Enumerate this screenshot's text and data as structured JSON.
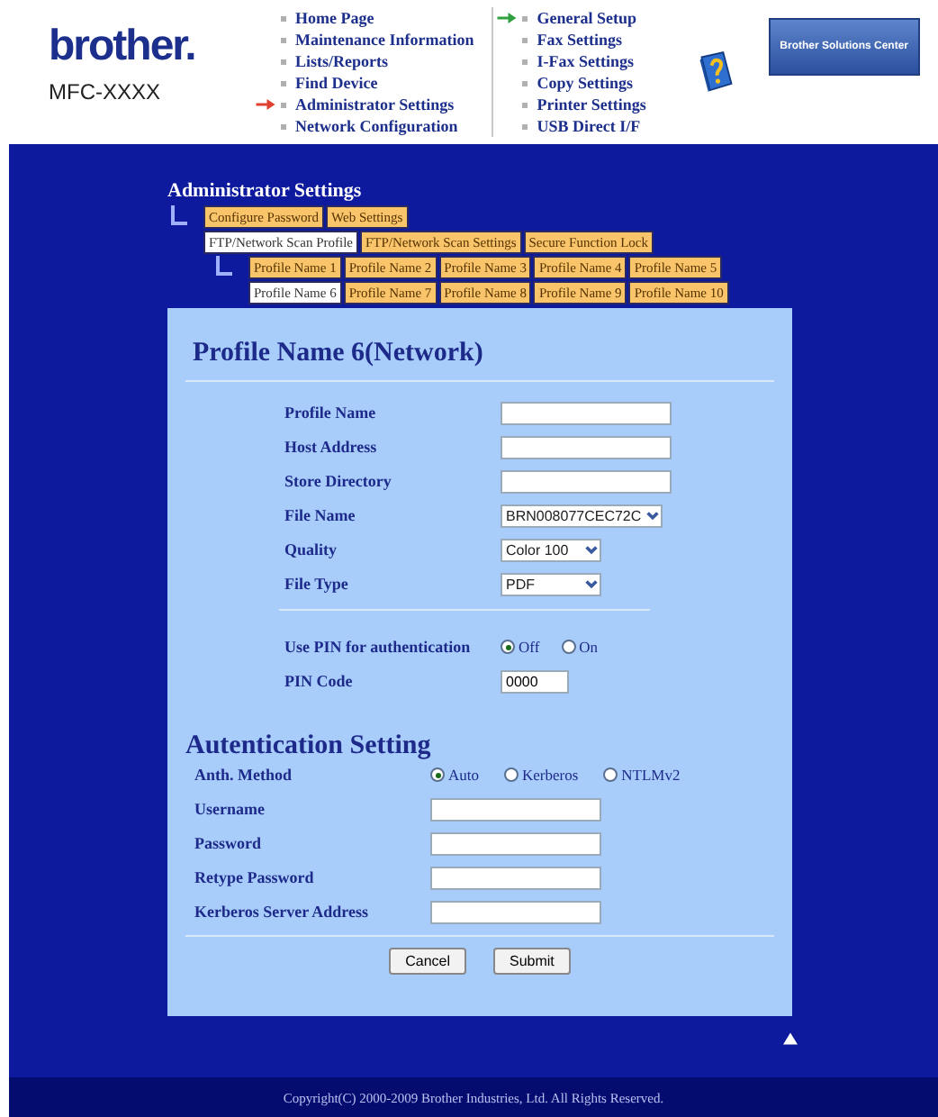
{
  "header": {
    "logo": "brother.",
    "model": "MFC-XXXX",
    "nav_columns": [
      [
        {
          "label": "Home Page"
        },
        {
          "label": "Maintenance Information"
        },
        {
          "label": "Lists/Reports"
        },
        {
          "label": "Find Device"
        },
        {
          "label": "Administrator Settings",
          "color": "#e04030"
        },
        {
          "label": "Network Configuration"
        }
      ],
      [
        {
          "label": "General Setup",
          "color": "#30a040"
        },
        {
          "label": "Fax Settings"
        },
        {
          "label": "I-Fax Settings"
        },
        {
          "label": "Copy Settings"
        },
        {
          "label": "Printer Settings"
        },
        {
          "label": "USB Direct I/F"
        }
      ]
    ],
    "solutions_center": "Brother Solutions Center"
  },
  "admin": {
    "title": "Administrator Settings",
    "tab_tree": {
      "rows": [
        [
          {
            "label": "Configure Password",
            "selected": false
          },
          {
            "label": "Web Settings",
            "selected": false
          }
        ],
        [
          {
            "label": "FTP/Network Scan Profile",
            "selected": true
          },
          {
            "label": "FTP/Network Scan Settings",
            "selected": false
          },
          {
            "label": "Secure Function Lock",
            "selected": false
          }
        ]
      ],
      "child": {
        "rows": [
          [
            {
              "label": "Profile Name 1",
              "selected": false
            },
            {
              "label": "Profile Name 2",
              "selected": false
            },
            {
              "label": "Profile Name 3",
              "selected": false
            },
            {
              "label": "Profile Name 4",
              "selected": false
            },
            {
              "label": "Profile Name 5",
              "selected": false
            }
          ],
          [
            {
              "label": "Profile Name 6",
              "selected": true
            },
            {
              "label": "Profile Name 7",
              "selected": false
            },
            {
              "label": "Profile Name 8",
              "selected": false
            },
            {
              "label": "Profile Name 9",
              "selected": false
            },
            {
              "label": "Profile Name 10",
              "selected": false
            }
          ]
        ]
      }
    }
  },
  "form": {
    "sections": [
      {
        "title": "Profile Name 6(Network)",
        "groups": [
          [
            {
              "kind": "text",
              "label": "Profile Name"
            },
            {
              "kind": "text",
              "label": "Host Address"
            },
            {
              "kind": "text",
              "label": "Store Directory"
            },
            {
              "kind": "select",
              "label": "File Name",
              "value": "BRN008077CEC72C"
            },
            {
              "kind": "select",
              "label": "Quality",
              "value": "Color 100"
            },
            {
              "kind": "select",
              "label": "File Type",
              "value": "PDF"
            }
          ],
          [
            {
              "kind": "radio",
              "label": "Use PIN for authentication",
              "options": [
                {
                  "label": "Off",
                  "selected": true
                },
                {
                  "label": "On",
                  "selected": false
                }
              ]
            },
            {
              "kind": "text",
              "label": "PIN Code",
              "value": "0000"
            }
          ]
        ]
      },
      {
        "title": "Autentication Setting",
        "groups": [
          [
            {
              "kind": "radio",
              "label": "Anth. Method",
              "options": [
                {
                  "label": "Auto",
                  "selected": true
                },
                {
                  "label": "Kerberos",
                  "selected": false
                },
                {
                  "label": "NTLMv2",
                  "selected": false
                }
              ]
            },
            {
              "kind": "text",
              "label": "Username"
            },
            {
              "kind": "text",
              "label": "Password"
            },
            {
              "kind": "text",
              "label": "Retype Password"
            },
            {
              "kind": "text",
              "label": "Kerberos Server Address"
            }
          ]
        ]
      }
    ],
    "buttons": [
      "Cancel",
      "Submit"
    ]
  },
  "copyright": "Copyright(C) 2000-2009 Brother Industries, Ltd. All Rights Reserved."
}
